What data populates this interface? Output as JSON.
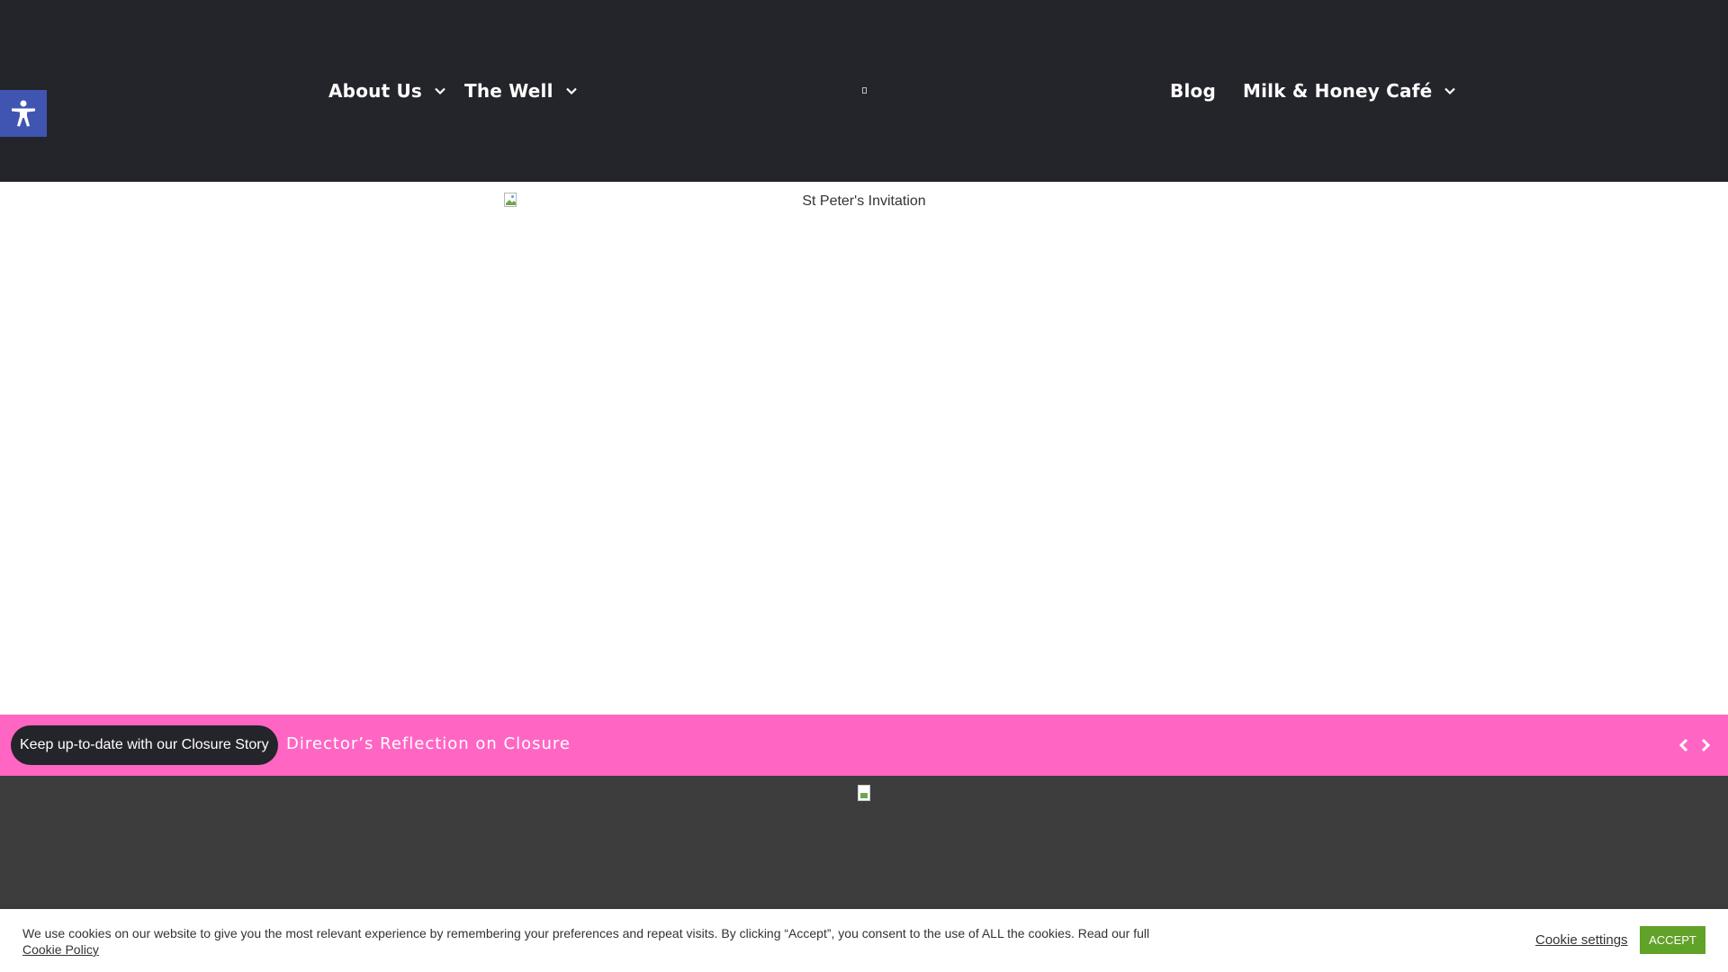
{
  "header": {
    "nav": [
      {
        "label": "About Us",
        "has_dropdown": true
      },
      {
        "label": "The Well",
        "has_dropdown": true
      },
      {
        "label": "Blog",
        "has_dropdown": false
      },
      {
        "label": "Milk & Honey Café",
        "has_dropdown": true
      }
    ],
    "logo_icon": "broken-image-icon",
    "background": "#24242b"
  },
  "accessibility": {
    "icon": "accessibility-person-icon",
    "color": "#4054b2"
  },
  "hero": {
    "image_alt": "St Peter's Invitation",
    "icon": "broken-image-icon"
  },
  "ticker": {
    "label": "Keep up-to-date with our Closure Story",
    "headline": "Director’s Reflection on Closure",
    "prev_icon": "chevron-left-icon",
    "next_icon": "chevron-right-icon",
    "background": "#ff66c4"
  },
  "dark_section": {
    "icon": "broken-image-icon",
    "background": "#3d3d3d"
  },
  "cookie": {
    "message": "We use cookies on our website to give you the most relevant experience by remembering your preferences and repeat visits. By clicking “Accept”, you consent to the use of ALL the cookies. Read our full",
    "policy_link": "Cookie Policy",
    "settings_label": "Cookie settings",
    "accept_label": "ACCEPT",
    "accept_color": "#61a229"
  }
}
